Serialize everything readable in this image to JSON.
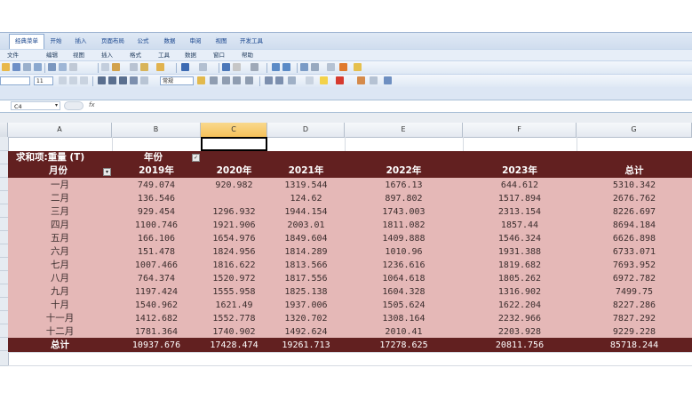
{
  "ribbon": {
    "tabs": [
      "经典菜单",
      "开始",
      "插入",
      "页面布局",
      "公式",
      "数据",
      "审阅",
      "视图",
      "开发工具"
    ],
    "menus": [
      "文件",
      "编辑",
      "视图",
      "插入",
      "格式",
      "工具",
      "数据",
      "窗口",
      "帮助"
    ],
    "font_size": "11",
    "number_format": "常规"
  },
  "formula_bar": {
    "name_box": "C4",
    "fx": "fx"
  },
  "columns": [
    "A",
    "B",
    "C",
    "D",
    "E",
    "F",
    "G"
  ],
  "pivot": {
    "title": "求和项:重量 (T)",
    "col_field": "年份",
    "row_field": "月份",
    "headers": [
      "2019年",
      "2020年",
      "2021年",
      "2022年",
      "2023年",
      "总计"
    ],
    "rows": [
      {
        "month": "一月",
        "values": [
          "749.074",
          "920.982",
          "1319.544",
          "1676.13",
          "644.612",
          "5310.342"
        ]
      },
      {
        "month": "二月",
        "values": [
          "136.546",
          "",
          "124.62",
          "897.802",
          "1517.894",
          "2676.762"
        ]
      },
      {
        "month": "三月",
        "values": [
          "929.454",
          "1296.932",
          "1944.154",
          "1743.003",
          "2313.154",
          "8226.697"
        ]
      },
      {
        "month": "四月",
        "values": [
          "1100.746",
          "1921.906",
          "2003.01",
          "1811.082",
          "1857.44",
          "8694.184"
        ]
      },
      {
        "month": "五月",
        "values": [
          "166.106",
          "1654.976",
          "1849.604",
          "1409.888",
          "1546.324",
          "6626.898"
        ]
      },
      {
        "month": "六月",
        "values": [
          "151.478",
          "1824.956",
          "1814.289",
          "1010.96",
          "1931.388",
          "6733.071"
        ]
      },
      {
        "month": "七月",
        "values": [
          "1007.466",
          "1816.622",
          "1813.566",
          "1236.616",
          "1819.682",
          "7693.952"
        ]
      },
      {
        "month": "八月",
        "values": [
          "764.374",
          "1520.972",
          "1817.556",
          "1064.618",
          "1805.262",
          "6972.782"
        ]
      },
      {
        "month": "九月",
        "values": [
          "1197.424",
          "1555.958",
          "1825.138",
          "1604.328",
          "1316.902",
          "7499.75"
        ]
      },
      {
        "month": "十月",
        "values": [
          "1540.962",
          "1621.49",
          "1937.006",
          "1505.624",
          "1622.204",
          "8227.286"
        ]
      },
      {
        "month": "十一月",
        "values": [
          "1412.682",
          "1552.778",
          "1320.702",
          "1308.164",
          "2232.966",
          "7827.292"
        ]
      },
      {
        "month": "十二月",
        "values": [
          "1781.364",
          "1740.902",
          "1492.624",
          "2010.41",
          "2203.928",
          "9229.228"
        ]
      }
    ],
    "total": {
      "label": "总计",
      "values": [
        "10937.676",
        "17428.474",
        "19261.713",
        "17278.625",
        "20811.756",
        "85718.244"
      ]
    }
  },
  "colors": {
    "pivot_dark": "#622020",
    "pivot_light": "#e5b8b7",
    "selected_col": "#f5c15a"
  },
  "icons": [
    "save-icon",
    "print-icon",
    "undo-icon",
    "redo-icon",
    "sum-icon",
    "sort-icon",
    "chart-icon",
    "fill-color-icon",
    "font-color-icon",
    "dropdown-arrow-icon",
    "filter-checkbox-icon"
  ]
}
